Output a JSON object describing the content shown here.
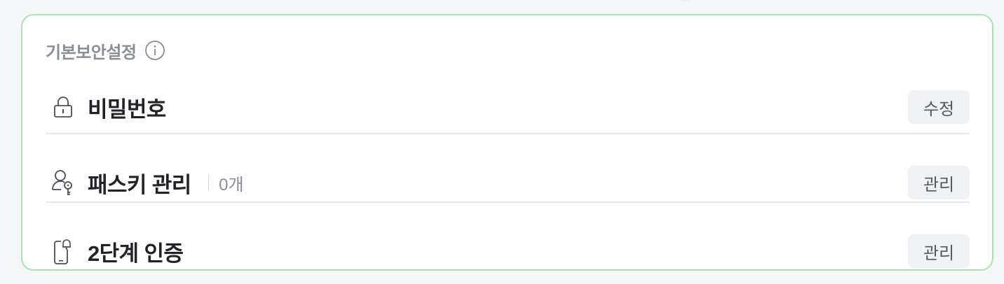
{
  "section": {
    "title": "기본보안설정",
    "info_icon": "info-circle-icon"
  },
  "rows": [
    {
      "label": "비밀번호",
      "icon": "lock-icon",
      "button": "수정"
    },
    {
      "label": "패스키 관리",
      "icon": "user-key-icon",
      "count": "0개",
      "button": "관리"
    },
    {
      "label": "2단계 인증",
      "icon": "phone-notification-icon",
      "button": "관리"
    }
  ],
  "colors": {
    "card_border": "#a8e2b4",
    "title": "#8a8d94",
    "label": "#222326",
    "button_bg": "#f0f1f3"
  }
}
